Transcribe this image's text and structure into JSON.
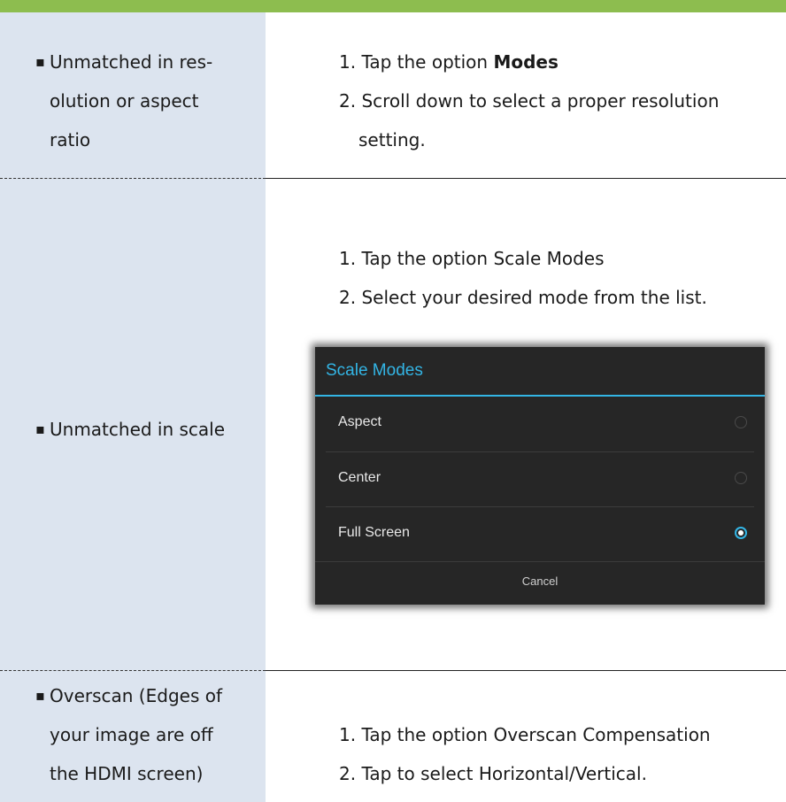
{
  "colors": {
    "accent_bar": "#8dbd4f",
    "left_panel": "#dce4ef",
    "dialog_bg": "#262626",
    "dialog_accent": "#33b5e5"
  },
  "rows": [
    {
      "issue_lines": [
        "Unmatched in res-",
        "olution or aspect",
        "ratio"
      ],
      "steps": [
        {
          "num": "1.",
          "prefix": "Tap the option ",
          "bold": "Modes"
        },
        {
          "num": "2.",
          "line1": "Scroll down to select a proper resolution",
          "line2": "setting."
        }
      ]
    },
    {
      "issue_lines": [
        "Unmatched in scale"
      ],
      "steps": [
        {
          "num": "1.",
          "text": "Tap the option Scale Modes"
        },
        {
          "num": "2.",
          "text": "Select your desired mode from the list."
        }
      ],
      "dialog": {
        "title": "Scale Modes",
        "options": [
          {
            "label": "Aspect",
            "selected": false
          },
          {
            "label": "Center",
            "selected": false
          },
          {
            "label": "Full Screen",
            "selected": true
          }
        ],
        "cancel_label": "Cancel"
      }
    },
    {
      "issue_lines": [
        "Overscan (Edges of",
        "your image are off",
        "the HDMI screen)"
      ],
      "steps": [
        {
          "num": "1.",
          "text": "Tap the option Overscan Compensation"
        },
        {
          "num": "2.",
          "text": "Tap to select Horizontal/Vertical."
        }
      ]
    }
  ]
}
